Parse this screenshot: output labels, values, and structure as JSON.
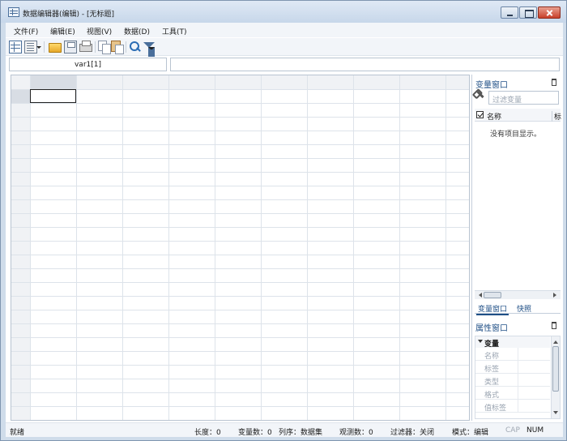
{
  "window": {
    "title": "数据编辑器(编辑) - [无标题]"
  },
  "menu": {
    "items": [
      "文件(F)",
      "编辑(E)",
      "视图(V)",
      "数据(D)",
      "工具(T)"
    ]
  },
  "toolbar": {
    "icons": [
      "grid-view-icon",
      "variable-view-icon",
      "open-folder-icon",
      "save-icon",
      "print-icon",
      "copy-icon",
      "paste-icon",
      "find-icon",
      "filter-icon"
    ]
  },
  "formula_bar": {
    "cell_reference": "var1[1]",
    "cell_value": ""
  },
  "variable_window": {
    "title": "变量窗口",
    "filter_placeholder": "过滤变量",
    "col_name": "名称",
    "col_label": "标",
    "empty_message": "没有项目显示。",
    "tabs": [
      "变量窗口",
      "快照"
    ]
  },
  "property_window": {
    "title": "属性窗口",
    "group": "变量",
    "rows": [
      "名称",
      "标签",
      "类型",
      "格式",
      "值标签"
    ]
  },
  "status_bar": {
    "ready": "就绪",
    "length": "长度：0",
    "var_count": "变量数：0",
    "order": "列序：数据集",
    "obs_count": "观测数：0",
    "filter": "过滤器：关闭",
    "mode": "模式：编辑",
    "cap": "CAP",
    "num": "NUM"
  }
}
